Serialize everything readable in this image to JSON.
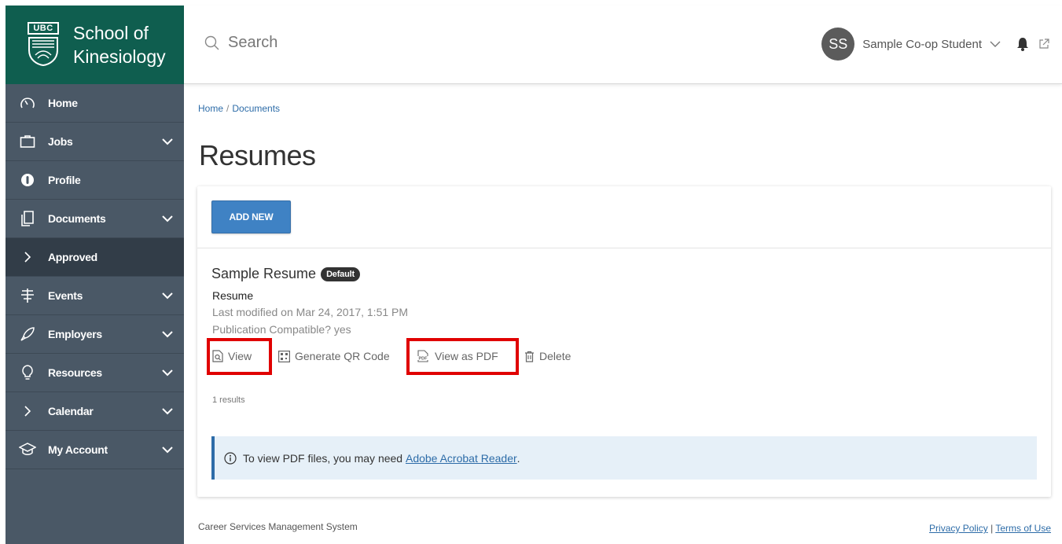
{
  "brand": {
    "logo_text": "UBC",
    "line1": "School of",
    "line2": "Kinesiology"
  },
  "search": {
    "placeholder": "Search"
  },
  "user": {
    "initials": "SS",
    "name": "Sample Co-op Student"
  },
  "nav": [
    {
      "label": "Home",
      "icon": "dashboard-icon",
      "chevron": false
    },
    {
      "label": "Jobs",
      "icon": "briefcase-icon",
      "chevron": true
    },
    {
      "label": "Profile",
      "icon": "profile-icon",
      "chevron": false
    },
    {
      "label": "Documents",
      "icon": "documents-icon",
      "chevron": true
    },
    {
      "label": "Approved",
      "icon": "chevron-right-icon",
      "chevron": false,
      "active": true
    },
    {
      "label": "Events",
      "icon": "signpost-icon",
      "chevron": true
    },
    {
      "label": "Employers",
      "icon": "rocket-icon",
      "chevron": true
    },
    {
      "label": "Resources",
      "icon": "lightbulb-icon",
      "chevron": true
    },
    {
      "label": "Calendar",
      "icon": "chevron-right-icon",
      "chevron": true
    },
    {
      "label": "My Account",
      "icon": "graduation-cap-icon",
      "chevron": true
    }
  ],
  "breadcrumb": {
    "home": "Home",
    "separator": "/",
    "current": "Documents"
  },
  "page": {
    "title": "Resumes"
  },
  "card": {
    "add_button": "ADD NEW",
    "resume": {
      "title": "Sample Resume",
      "badge": "Default",
      "type": "Resume",
      "modified": "Last modified on Mar 24, 2017, 1:51 PM",
      "publication": "Publication Compatible? yes"
    },
    "actions": {
      "view": "View",
      "qr": "Generate QR Code",
      "pdf": "View as PDF",
      "delete": "Delete"
    },
    "results": "1 results",
    "alert": {
      "text": "To view PDF files, you may need ",
      "link": "Adobe Acrobat Reader",
      "end": "."
    }
  },
  "footer": {
    "left": "Career Services Management System",
    "privacy": "Privacy Policy",
    "sep": " | ",
    "terms": "Terms of Use"
  },
  "colors": {
    "sidebar": "#4a5866",
    "brand": "#0f5e4f",
    "accent": "#3f82c4",
    "highlight": "#e00000"
  }
}
